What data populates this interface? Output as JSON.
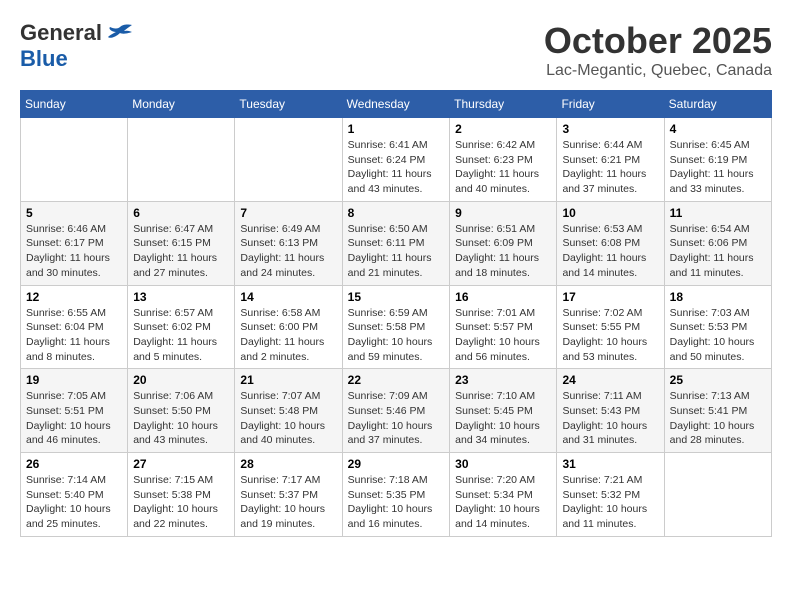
{
  "header": {
    "logo": {
      "general": "General",
      "blue": "Blue",
      "bird_unicode": "🐦"
    },
    "title": "October 2025",
    "location": "Lac-Megantic, Quebec, Canada"
  },
  "weekdays": [
    "Sunday",
    "Monday",
    "Tuesday",
    "Wednesday",
    "Thursday",
    "Friday",
    "Saturday"
  ],
  "weeks": [
    [
      {
        "day": "",
        "info": ""
      },
      {
        "day": "",
        "info": ""
      },
      {
        "day": "",
        "info": ""
      },
      {
        "day": "1",
        "info": "Sunrise: 6:41 AM\nSunset: 6:24 PM\nDaylight: 11 hours\nand 43 minutes."
      },
      {
        "day": "2",
        "info": "Sunrise: 6:42 AM\nSunset: 6:23 PM\nDaylight: 11 hours\nand 40 minutes."
      },
      {
        "day": "3",
        "info": "Sunrise: 6:44 AM\nSunset: 6:21 PM\nDaylight: 11 hours\nand 37 minutes."
      },
      {
        "day": "4",
        "info": "Sunrise: 6:45 AM\nSunset: 6:19 PM\nDaylight: 11 hours\nand 33 minutes."
      }
    ],
    [
      {
        "day": "5",
        "info": "Sunrise: 6:46 AM\nSunset: 6:17 PM\nDaylight: 11 hours\nand 30 minutes."
      },
      {
        "day": "6",
        "info": "Sunrise: 6:47 AM\nSunset: 6:15 PM\nDaylight: 11 hours\nand 27 minutes."
      },
      {
        "day": "7",
        "info": "Sunrise: 6:49 AM\nSunset: 6:13 PM\nDaylight: 11 hours\nand 24 minutes."
      },
      {
        "day": "8",
        "info": "Sunrise: 6:50 AM\nSunset: 6:11 PM\nDaylight: 11 hours\nand 21 minutes."
      },
      {
        "day": "9",
        "info": "Sunrise: 6:51 AM\nSunset: 6:09 PM\nDaylight: 11 hours\nand 18 minutes."
      },
      {
        "day": "10",
        "info": "Sunrise: 6:53 AM\nSunset: 6:08 PM\nDaylight: 11 hours\nand 14 minutes."
      },
      {
        "day": "11",
        "info": "Sunrise: 6:54 AM\nSunset: 6:06 PM\nDaylight: 11 hours\nand 11 minutes."
      }
    ],
    [
      {
        "day": "12",
        "info": "Sunrise: 6:55 AM\nSunset: 6:04 PM\nDaylight: 11 hours\nand 8 minutes."
      },
      {
        "day": "13",
        "info": "Sunrise: 6:57 AM\nSunset: 6:02 PM\nDaylight: 11 hours\nand 5 minutes."
      },
      {
        "day": "14",
        "info": "Sunrise: 6:58 AM\nSunset: 6:00 PM\nDaylight: 11 hours\nand 2 minutes."
      },
      {
        "day": "15",
        "info": "Sunrise: 6:59 AM\nSunset: 5:58 PM\nDaylight: 10 hours\nand 59 minutes."
      },
      {
        "day": "16",
        "info": "Sunrise: 7:01 AM\nSunset: 5:57 PM\nDaylight: 10 hours\nand 56 minutes."
      },
      {
        "day": "17",
        "info": "Sunrise: 7:02 AM\nSunset: 5:55 PM\nDaylight: 10 hours\nand 53 minutes."
      },
      {
        "day": "18",
        "info": "Sunrise: 7:03 AM\nSunset: 5:53 PM\nDaylight: 10 hours\nand 50 minutes."
      }
    ],
    [
      {
        "day": "19",
        "info": "Sunrise: 7:05 AM\nSunset: 5:51 PM\nDaylight: 10 hours\nand 46 minutes."
      },
      {
        "day": "20",
        "info": "Sunrise: 7:06 AM\nSunset: 5:50 PM\nDaylight: 10 hours\nand 43 minutes."
      },
      {
        "day": "21",
        "info": "Sunrise: 7:07 AM\nSunset: 5:48 PM\nDaylight: 10 hours\nand 40 minutes."
      },
      {
        "day": "22",
        "info": "Sunrise: 7:09 AM\nSunset: 5:46 PM\nDaylight: 10 hours\nand 37 minutes."
      },
      {
        "day": "23",
        "info": "Sunrise: 7:10 AM\nSunset: 5:45 PM\nDaylight: 10 hours\nand 34 minutes."
      },
      {
        "day": "24",
        "info": "Sunrise: 7:11 AM\nSunset: 5:43 PM\nDaylight: 10 hours\nand 31 minutes."
      },
      {
        "day": "25",
        "info": "Sunrise: 7:13 AM\nSunset: 5:41 PM\nDaylight: 10 hours\nand 28 minutes."
      }
    ],
    [
      {
        "day": "26",
        "info": "Sunrise: 7:14 AM\nSunset: 5:40 PM\nDaylight: 10 hours\nand 25 minutes."
      },
      {
        "day": "27",
        "info": "Sunrise: 7:15 AM\nSunset: 5:38 PM\nDaylight: 10 hours\nand 22 minutes."
      },
      {
        "day": "28",
        "info": "Sunrise: 7:17 AM\nSunset: 5:37 PM\nDaylight: 10 hours\nand 19 minutes."
      },
      {
        "day": "29",
        "info": "Sunrise: 7:18 AM\nSunset: 5:35 PM\nDaylight: 10 hours\nand 16 minutes."
      },
      {
        "day": "30",
        "info": "Sunrise: 7:20 AM\nSunset: 5:34 PM\nDaylight: 10 hours\nand 14 minutes."
      },
      {
        "day": "31",
        "info": "Sunrise: 7:21 AM\nSunset: 5:32 PM\nDaylight: 10 hours\nand 11 minutes."
      },
      {
        "day": "",
        "info": ""
      }
    ]
  ]
}
